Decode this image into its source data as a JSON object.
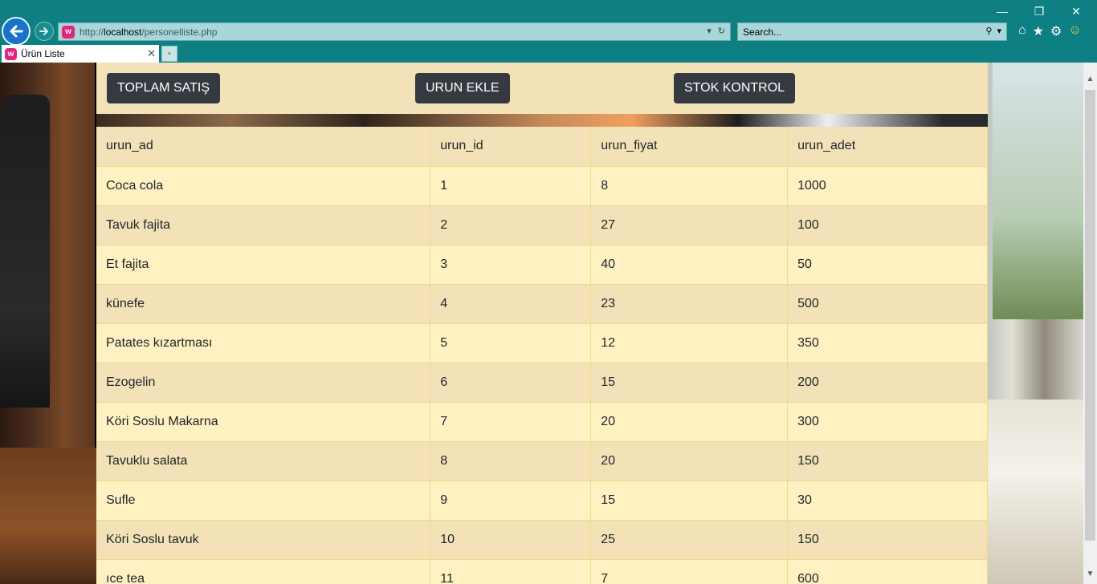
{
  "browser": {
    "url_prefix": "http://",
    "url_host": "localhost",
    "url_path": "/personelliste.php",
    "search_placeholder": "Search...",
    "tab_title": "Ürün Liste",
    "site_icon_glyph": "w",
    "window_controls": [
      "—",
      "❐",
      "✕"
    ],
    "toolbar_icons": [
      "home-icon",
      "favorites-star-icon",
      "settings-gear-icon",
      "smiley-feedback-icon"
    ]
  },
  "page": {
    "buttons": {
      "total_sales": "TOPLAM SATIŞ",
      "add_product": "URUN EKLE",
      "stock_control": "STOK KONTROL"
    },
    "table": {
      "headers": [
        "urun_ad",
        "urun_id",
        "urun_fiyat",
        "urun_adet"
      ],
      "rows": [
        [
          "Coca cola",
          "1",
          "8",
          "1000"
        ],
        [
          "Tavuk fajita",
          "2",
          "27",
          "100"
        ],
        [
          "Et fajita",
          "3",
          "40",
          "50"
        ],
        [
          "künefe",
          "4",
          "23",
          "500"
        ],
        [
          "Patates kızartması",
          "5",
          "12",
          "350"
        ],
        [
          "Ezogelin",
          "6",
          "15",
          "200"
        ],
        [
          "Köri Soslu Makarna",
          "7",
          "20",
          "300"
        ],
        [
          "Tavuklu salata",
          "8",
          "20",
          "150"
        ],
        [
          "Sufle",
          "9",
          "15",
          "30"
        ],
        [
          "Köri Soslu tavuk",
          "10",
          "25",
          "150"
        ],
        [
          "ıce tea",
          "11",
          "7",
          "600"
        ]
      ]
    }
  },
  "colors": {
    "chrome": "#0e7f82",
    "button": "#343a40",
    "row_light": "#fff1c2",
    "row_dark": "#f3e2b8"
  }
}
